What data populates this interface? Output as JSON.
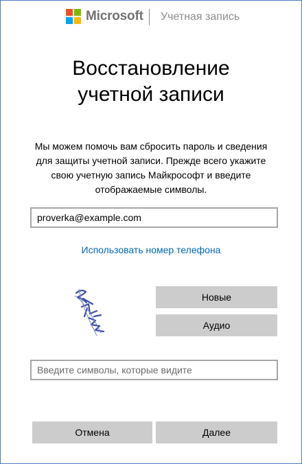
{
  "header": {
    "brand": "Microsoft",
    "section": "Учетная запись",
    "logo_colors": [
      "#f25022",
      "#7fba00",
      "#00a4ef",
      "#ffb900"
    ]
  },
  "title": {
    "line1": "Восстановление",
    "line2": "учетной записи"
  },
  "description": "Мы можем помочь вам сбросить пароль и сведения для защиты учетной записи. Прежде всего укажите свою учетную запись Майкрософт и введите отображаемые символы.",
  "email_field": {
    "value": "proverka@example.com",
    "placeholder": ""
  },
  "phone_link": "Использовать номер телефона",
  "captcha": {
    "new_label": "Новые",
    "audio_label": "Аудио",
    "input_placeholder": "Введите символы, которые видите"
  },
  "footer": {
    "cancel_label": "Отмена",
    "next_label": "Далее"
  },
  "colors": {
    "link": "#0067b8",
    "button_bg": "#cccccc",
    "window_border": "#4a7dbf",
    "captcha_ink": "#3b4fa8"
  }
}
